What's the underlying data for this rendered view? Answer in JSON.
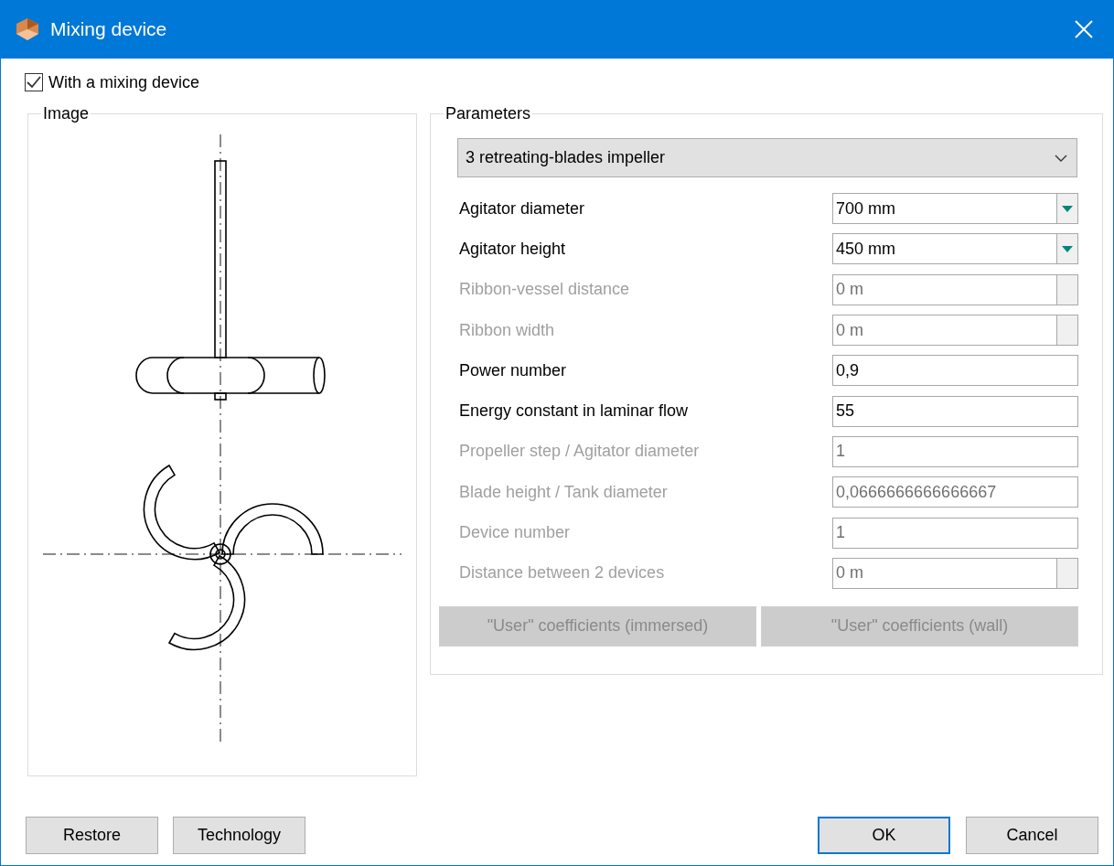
{
  "window": {
    "title": "Mixing device"
  },
  "mixing_checkbox": {
    "label": "With a mixing device",
    "checked": true
  },
  "image_group": {
    "title": "Image"
  },
  "parameters": {
    "title": "Parameters",
    "device_type": "3 retreating-blades impeller",
    "fields": [
      {
        "label": "Agitator diameter",
        "value": "700 mm",
        "kind": "dropdown",
        "disabled": false
      },
      {
        "label": "Agitator height",
        "value": "450 mm",
        "kind": "dropdown",
        "disabled": false
      },
      {
        "label": "Ribbon-vessel distance",
        "value": "0 m",
        "kind": "unit",
        "disabled": true
      },
      {
        "label": "Ribbon width",
        "value": "0 m",
        "kind": "unit",
        "disabled": true
      },
      {
        "label": "Power number",
        "value": "0,9",
        "kind": "text",
        "disabled": false
      },
      {
        "label": "Energy constant in laminar flow",
        "value": "55",
        "kind": "text",
        "disabled": false
      },
      {
        "label": "Propeller step / Agitator diameter",
        "value": "1",
        "kind": "text",
        "disabled": true
      },
      {
        "label": "Blade height / Tank diameter",
        "value": "0,0666666666666667",
        "kind": "text",
        "disabled": true
      },
      {
        "label": "Device number",
        "value": "1",
        "kind": "text",
        "disabled": true
      },
      {
        "label": "Distance between 2 devices",
        "value": "0 m",
        "kind": "unit",
        "disabled": true
      }
    ],
    "coefficient_buttons": [
      {
        "label": "\"User\" coefficients (immersed)",
        "disabled": true
      },
      {
        "label": "\"User\" coefficients (wall)",
        "disabled": true
      }
    ]
  },
  "buttons_left": [
    {
      "label": "Restore",
      "default": false
    },
    {
      "label": "Technology",
      "default": false
    }
  ],
  "buttons_right": [
    {
      "label": "OK",
      "default": true
    },
    {
      "label": "Cancel",
      "default": false
    }
  ]
}
